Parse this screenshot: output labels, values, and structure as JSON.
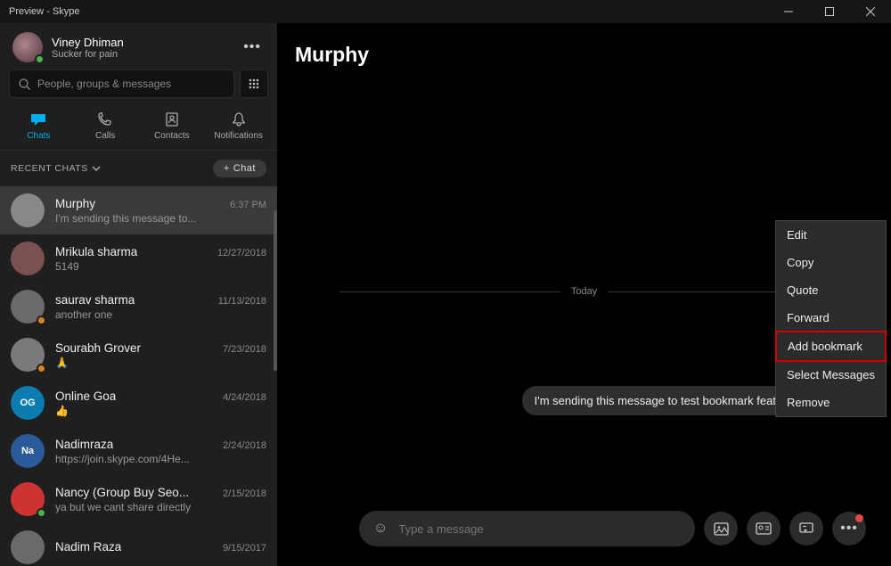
{
  "window": {
    "title": "Preview - Skype"
  },
  "profile": {
    "name": "Viney Dhiman",
    "mood": "Sucker for pain"
  },
  "search": {
    "placeholder": "People, groups & messages"
  },
  "tabs": {
    "chats": "Chats",
    "calls": "Calls",
    "contacts": "Contacts",
    "notifications": "Notifications"
  },
  "section": {
    "recent": "RECENT CHATS",
    "new_chat": "Chat"
  },
  "chats": [
    {
      "name": "Murphy",
      "time": "6:37 PM",
      "preview": "I'm sending this message to...",
      "initials": "",
      "color": "#888",
      "presence": ""
    },
    {
      "name": "Mrikula sharma",
      "time": "12/27/2018",
      "preview": "5149",
      "initials": "",
      "color": "#7a5050",
      "presence": ""
    },
    {
      "name": "saurav sharma",
      "time": "11/13/2018",
      "preview": "another one",
      "initials": "",
      "color": "#6a6a6a",
      "presence": "#d68227"
    },
    {
      "name": "Sourabh Grover",
      "time": "7/23/2018",
      "preview": "🙏",
      "initials": "",
      "color": "#7a7a7a",
      "presence": "#d68227"
    },
    {
      "name": "Online Goa",
      "time": "4/24/2018",
      "preview": "👍",
      "initials": "OG",
      "color": "#0b7bb0",
      "presence": ""
    },
    {
      "name": "Nadimraza",
      "time": "2/24/2018",
      "preview": "https://join.skype.com/4He...",
      "initials": "Na",
      "color": "#2a5a9a",
      "presence": ""
    },
    {
      "name": "Nancy (Group Buy Seo...",
      "time": "2/15/2018",
      "preview": "ya but we cant share directly",
      "initials": "",
      "color": "#c33",
      "presence": "#4bb34b"
    },
    {
      "name": "Nadim Raza",
      "time": "9/15/2017",
      "preview": "",
      "initials": "",
      "color": "#6a6a6a",
      "presence": ""
    }
  ],
  "conversation": {
    "title": "Murphy",
    "date_separator": "Today",
    "message": "I'm sending this message to test bookmark feature in skype",
    "composer_placeholder": "Type a message"
  },
  "context_menu": {
    "edit": "Edit",
    "copy": "Copy",
    "quote": "Quote",
    "forward": "Forward",
    "bookmark": "Add bookmark",
    "select": "Select Messages",
    "remove": "Remove"
  }
}
